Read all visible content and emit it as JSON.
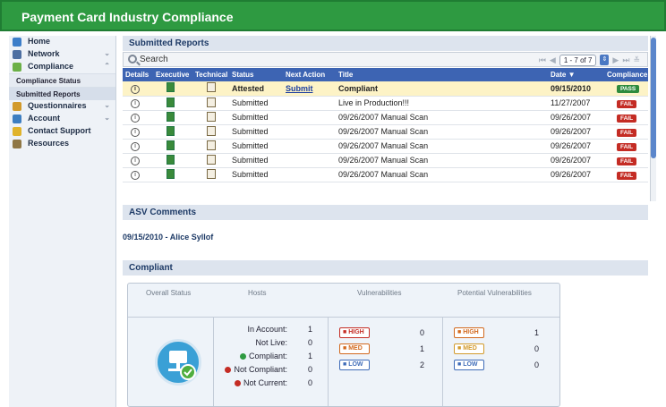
{
  "window": {
    "title": "Payment Card Industry Compliance"
  },
  "sidebar": {
    "items": [
      {
        "label": "Home",
        "icon": "home-icon",
        "color": "#3c7ec9",
        "expandable": false
      },
      {
        "label": "Network",
        "icon": "network-icon",
        "color": "#4d6fa1",
        "expandable": true
      },
      {
        "label": "Compliance",
        "icon": "check-icon",
        "color": "#6bb047",
        "expandable": true,
        "expanded": true
      }
    ],
    "subitems": [
      {
        "label": "Compliance Status"
      },
      {
        "label": "Submitted Reports",
        "selected": true
      }
    ],
    "items2": [
      {
        "label": "Questionnaires",
        "icon": "pencil-icon",
        "color": "#d29a2b",
        "expandable": true
      },
      {
        "label": "Account",
        "icon": "user-icon",
        "color": "#3d7ec1",
        "expandable": true
      },
      {
        "label": "Contact Support",
        "icon": "chat-icon",
        "color": "#e0b32b",
        "expandable": false
      },
      {
        "label": "Resources",
        "icon": "book-icon",
        "color": "#8f7745",
        "expandable": false
      }
    ]
  },
  "reports": {
    "title": "Submitted Reports",
    "search_label": "Search",
    "pager": {
      "range": "1 - 7 of 7"
    },
    "columns": [
      "Details",
      "Executive",
      "Technical",
      "Status",
      "Next Action",
      "Title",
      "Date",
      "Compliance"
    ],
    "rows": [
      {
        "status": "Attested",
        "next_action": "Submit",
        "title": "Compliant",
        "date": "09/15/2010",
        "compliance": "PASS",
        "highlight": true
      },
      {
        "status": "Submitted",
        "next_action": "",
        "title": "Live in Production!!!",
        "date": "11/27/2007",
        "compliance": "FAIL"
      },
      {
        "status": "Submitted",
        "next_action": "",
        "title": "09/26/2007 Manual Scan",
        "date": "09/26/2007",
        "compliance": "FAIL"
      },
      {
        "status": "Submitted",
        "next_action": "",
        "title": "09/26/2007 Manual Scan",
        "date": "09/26/2007",
        "compliance": "FAIL"
      },
      {
        "status": "Submitted",
        "next_action": "",
        "title": "09/26/2007 Manual Scan",
        "date": "09/26/2007",
        "compliance": "FAIL"
      },
      {
        "status": "Submitted",
        "next_action": "",
        "title": "09/26/2007 Manual Scan",
        "date": "09/26/2007",
        "compliance": "FAIL"
      },
      {
        "status": "Submitted",
        "next_action": "",
        "title": "09/26/2007 Manual Scan",
        "date": "09/26/2007",
        "compliance": "FAIL"
      }
    ]
  },
  "asv": {
    "title": "ASV Comments",
    "entry": "09/15/2010 - Alice Syllof"
  },
  "compliant": {
    "title": "Compliant",
    "headers": {
      "overall": "Overall Status",
      "hosts": "Hosts",
      "vulns": "Vulnerabilities",
      "potential": "Potential Vulnerabilities"
    },
    "hosts": [
      {
        "label": "In Account:",
        "value": "1",
        "dot": ""
      },
      {
        "label": "Not Live:",
        "value": "0",
        "dot": ""
      },
      {
        "label": "Compliant:",
        "value": "1",
        "dot": "#2e9a41"
      },
      {
        "label": "Not Compliant:",
        "value": "0",
        "dot": "#c42c24"
      },
      {
        "label": "Not Current:",
        "value": "0",
        "dot": "#c42c24"
      }
    ],
    "vulnerabilities": [
      {
        "level": "HIGH",
        "value": "0"
      },
      {
        "level": "MED",
        "value": "1"
      },
      {
        "level": "LOW",
        "value": "2"
      }
    ],
    "potential": [
      {
        "level": "HIGH",
        "value": "1"
      },
      {
        "level": "MED",
        "value": "0"
      },
      {
        "level": "LOW",
        "value": "0"
      }
    ]
  }
}
